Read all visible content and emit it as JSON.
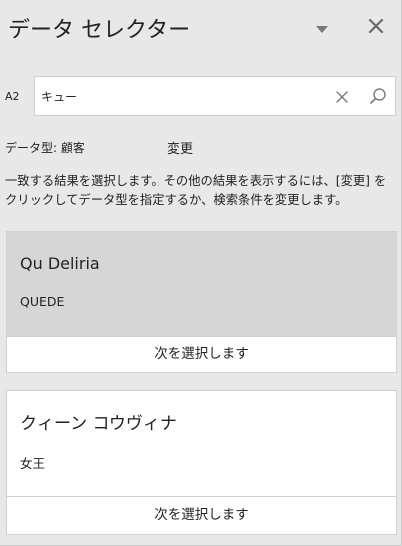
{
  "header": {
    "title": "データ セレクター",
    "dropdown_icon": "chevron-down-icon",
    "close_icon": "close-icon"
  },
  "search": {
    "cell_ref": "A2",
    "value": "キュー",
    "clear_icon": "close-icon",
    "search_icon": "search-icon"
  },
  "data_type": {
    "label": "データ型: 顧客",
    "change_label": "変更"
  },
  "description": "一致する結果を選択します。その他の結果を表示するには、[変更] をクリックしてデータ型を指定するか、検索条件を変更します。",
  "results": [
    {
      "name": "Qu Deliria",
      "sub": "QUEDE",
      "select_label": "次を選択します",
      "selected": true
    },
    {
      "name": "クィーン コウヴィナ",
      "sub": "女王",
      "select_label": "次を選択します",
      "selected": false
    }
  ],
  "colors": {
    "background": "#e8e8e8",
    "selected_card": "#d6d6d6",
    "card": "#ffffff",
    "border": "#d0d0d0",
    "icon": "#7a7a7a"
  }
}
